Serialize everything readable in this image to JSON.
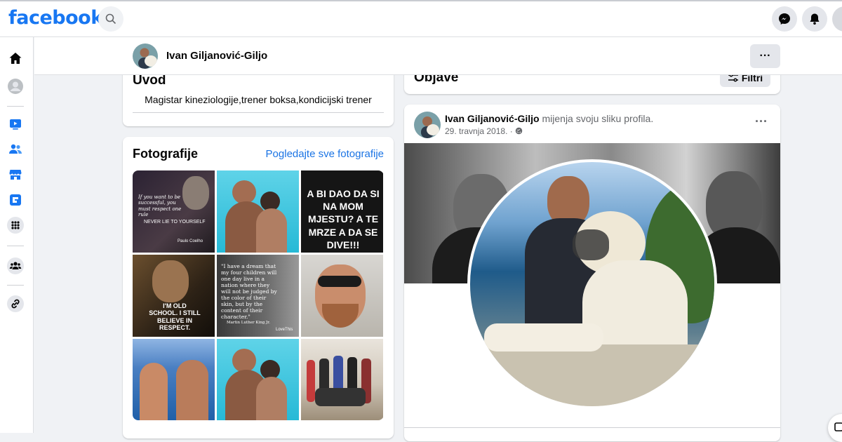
{
  "topbar": {
    "logo": "facebook",
    "icons": [
      "search-icon",
      "messenger-icon",
      "notifications-icon",
      "account-icon"
    ]
  },
  "leftrail": {
    "items": [
      "home-icon",
      "profile-icon",
      "watch-icon",
      "friends-icon",
      "marketplace-icon",
      "gaming-icon",
      "menu-grid-icon",
      "groups-icon",
      "link-icon"
    ]
  },
  "profile_header": {
    "name": "Ivan Giljanović-Giljo",
    "more": "···"
  },
  "intro": {
    "title": "Uvod",
    "bio": "Magistar kineziologije,trener boksa,kondicijski trener"
  },
  "photos": {
    "title": "Fotografije",
    "see_all": "Pogledajte sve fotografije",
    "captions": {
      "p1": "If you want to be successful, you must respect one rule",
      "p1_rule": "NEVER LIE TO YOURSELF",
      "p1_author": "Paulo Coelho",
      "p3": "A BI DAO DA SI NA MOM MJESTU? A TE MRZE A DA SE DIVE!!!",
      "p4": "I'M OLD SCHOOL. I STILL BELIEVE IN RESPECT.",
      "p5": "\"I have a dream that my four children will one day live in a nation where they will not be judged by the color of their skin, but by the content of their character.\"",
      "p5_author": "Martin Luther King Jr.",
      "p5_source": "LoveThis"
    }
  },
  "posts": {
    "title": "Objave",
    "filters": "Filtri",
    "post": {
      "author": "Ivan Giljanović-Giljo",
      "action": "mijenja svoju sliku profila.",
      "date": "29. travnja 2018. ·",
      "more": "···"
    }
  },
  "colors": {
    "brand": "#1877f2",
    "link": "#1b74e4",
    "bg": "#f0f2f5"
  }
}
